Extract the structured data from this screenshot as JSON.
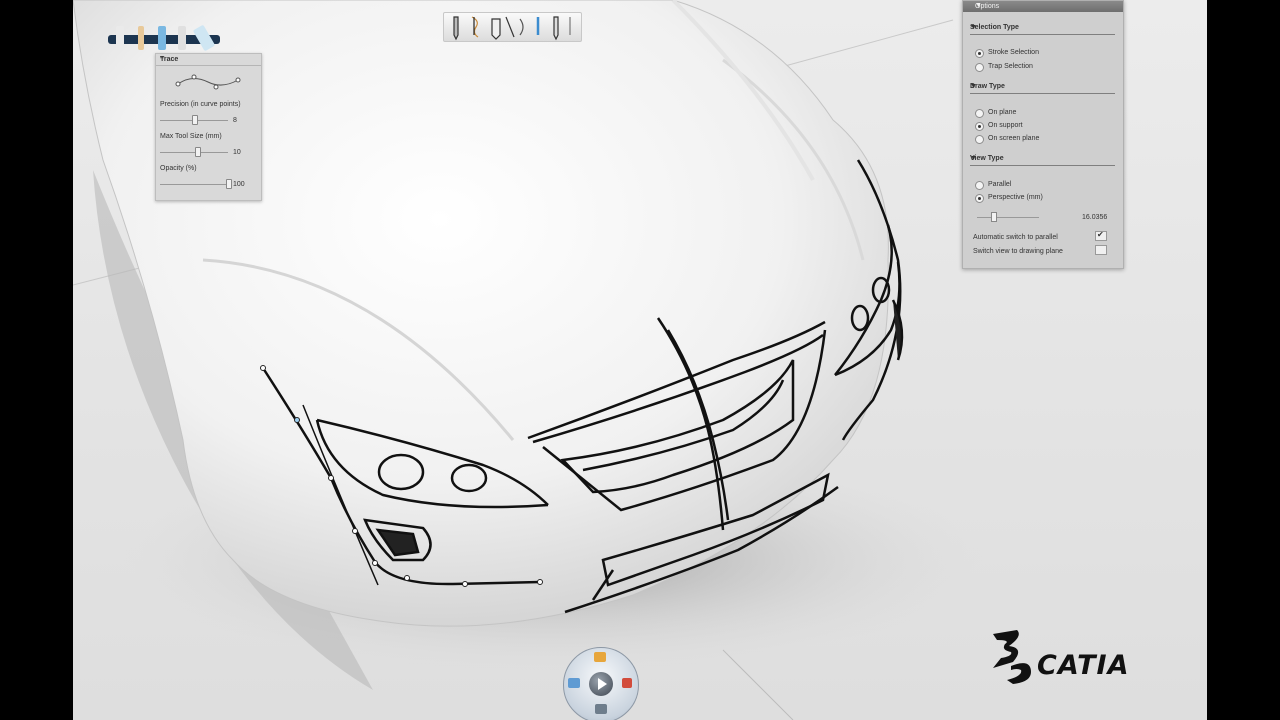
{
  "trace_panel": {
    "title": "Trace",
    "minimize": "–",
    "precision_label": "Precision (in curve points)",
    "precision_value": "8",
    "precision_fraction": 0.5,
    "max_tool_size_label": "Max Tool Size (mm)",
    "max_tool_size_value": "10",
    "max_tool_size_fraction": 0.55,
    "opacity_label": "Opacity (%)",
    "opacity_value": "100",
    "opacity_fraction": 1.0
  },
  "options_panel": {
    "title": "Options",
    "selection_type": {
      "heading": "Selection Type",
      "options": [
        {
          "label": "Stroke Selection",
          "selected": true
        },
        {
          "label": "Trap Selection",
          "selected": false
        }
      ]
    },
    "draw_type": {
      "heading": "Draw Type",
      "options": [
        {
          "label": "On plane",
          "selected": false
        },
        {
          "label": "On support",
          "selected": true
        },
        {
          "label": "On screen plane",
          "selected": false
        }
      ]
    },
    "view_type": {
      "heading": "View Type",
      "options": [
        {
          "label": "Parallel",
          "selected": false
        },
        {
          "label": "Perspective (mm)",
          "selected": true
        }
      ],
      "perspective_value": "16.0356",
      "perspective_fraction": 0.25
    },
    "automatic_switch_label": "Automatic switch to parallel",
    "automatic_switch_checked": true,
    "switch_view_label": "Switch view to drawing plane",
    "switch_view_checked": false
  },
  "logo": {
    "text": "CATIA"
  },
  "icons": {
    "dropdown": "▼",
    "check": "✔"
  },
  "colors": {
    "palette_bar": "#1c3550",
    "options_title": "#7a7a7a",
    "stroke": "#111111"
  }
}
